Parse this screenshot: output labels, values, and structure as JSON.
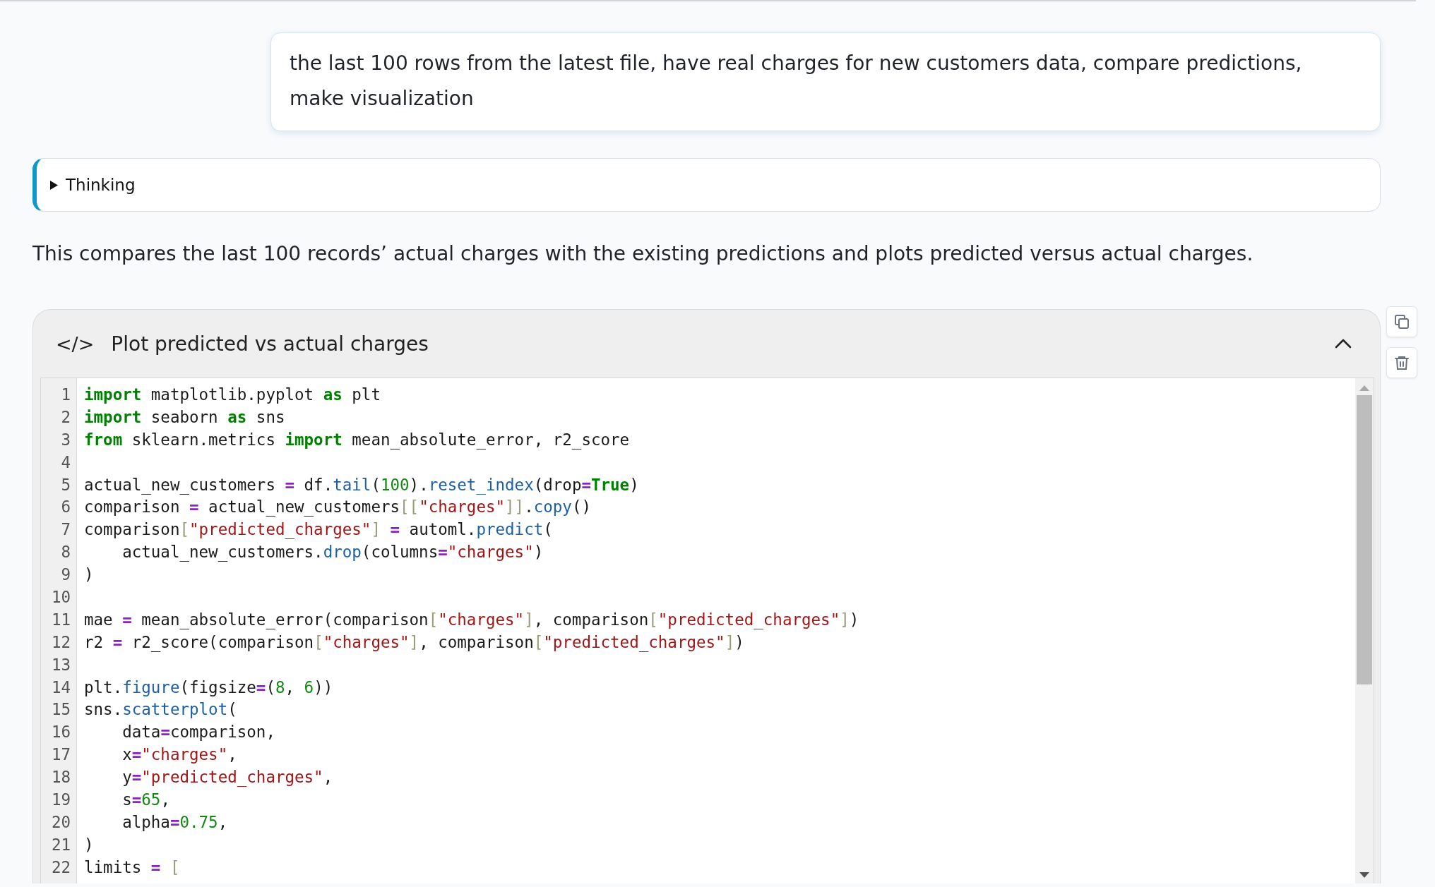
{
  "user_message": {
    "text": "the last 100 rows from the latest file, have real charges for new customers data, compare predictions, make visualization"
  },
  "thinking": {
    "label": "Thinking",
    "expanded": false
  },
  "assistant_text": "This compares the last 100 records’ actual charges with the existing predictions and plots predicted versus actual charges.",
  "code_block": {
    "tag": "</>",
    "title": "Plot predicted vs actual charges",
    "expanded": true,
    "lines": [
      {
        "number": "1",
        "tokens": [
          {
            "kind": "keyword",
            "text": "import"
          },
          {
            "kind": "plain",
            "text": " matplotlib.pyplot "
          },
          {
            "kind": "keyword",
            "text": "as"
          },
          {
            "kind": "plain",
            "text": " plt"
          }
        ]
      },
      {
        "number": "2",
        "tokens": [
          {
            "kind": "keyword",
            "text": "import"
          },
          {
            "kind": "plain",
            "text": " seaborn "
          },
          {
            "kind": "keyword",
            "text": "as"
          },
          {
            "kind": "plain",
            "text": " sns"
          }
        ]
      },
      {
        "number": "3",
        "tokens": [
          {
            "kind": "keyword",
            "text": "from"
          },
          {
            "kind": "plain",
            "text": " sklearn.metrics "
          },
          {
            "kind": "keyword",
            "text": "import"
          },
          {
            "kind": "plain",
            "text": " mean_absolute_error, r2_score"
          }
        ]
      },
      {
        "number": "4"
      },
      {
        "number": "5",
        "tokens": [
          {
            "kind": "plain",
            "text": "actual_new_customers "
          },
          {
            "kind": "operator",
            "text": "="
          },
          {
            "kind": "plain",
            "text": " df."
          },
          {
            "kind": "function",
            "text": "tail"
          },
          {
            "kind": "plain",
            "text": "("
          },
          {
            "kind": "number",
            "text": "100"
          },
          {
            "kind": "plain",
            "text": ")."
          },
          {
            "kind": "function",
            "text": "reset_index"
          },
          {
            "kind": "plain",
            "text": "(drop"
          },
          {
            "kind": "operator",
            "text": "="
          },
          {
            "kind": "keyword",
            "text": "True"
          },
          {
            "kind": "plain",
            "text": ")"
          }
        ]
      },
      {
        "number": "6",
        "tokens": [
          {
            "kind": "plain",
            "text": "comparison "
          },
          {
            "kind": "operator",
            "text": "="
          },
          {
            "kind": "plain",
            "text": " actual_new_customers"
          },
          {
            "kind": "bracket",
            "text": "[["
          },
          {
            "kind": "string",
            "text": "\"charges\""
          },
          {
            "kind": "bracket",
            "text": "]]"
          },
          {
            "kind": "plain",
            "text": "."
          },
          {
            "kind": "function",
            "text": "copy"
          },
          {
            "kind": "plain",
            "text": "()"
          }
        ]
      },
      {
        "number": "7",
        "tokens": [
          {
            "kind": "plain",
            "text": "comparison"
          },
          {
            "kind": "bracket",
            "text": "["
          },
          {
            "kind": "string",
            "text": "\"predicted_charges\""
          },
          {
            "kind": "bracket",
            "text": "]"
          },
          {
            "kind": "operator",
            "text": " ="
          },
          {
            "kind": "plain",
            "text": " automl."
          },
          {
            "kind": "function",
            "text": "predict"
          },
          {
            "kind": "plain",
            "text": "("
          }
        ]
      },
      {
        "number": "8",
        "tokens": [
          {
            "kind": "plain",
            "text": "    actual_new_customers."
          },
          {
            "kind": "function",
            "text": "drop"
          },
          {
            "kind": "plain",
            "text": "(columns"
          },
          {
            "kind": "operator",
            "text": "="
          },
          {
            "kind": "string",
            "text": "\"charges\""
          },
          {
            "kind": "plain",
            "text": ")"
          }
        ]
      },
      {
        "number": "9",
        "tokens": [
          {
            "kind": "plain",
            "text": ")"
          }
        ]
      },
      {
        "number": "10"
      },
      {
        "number": "11",
        "tokens": [
          {
            "kind": "plain",
            "text": "mae "
          },
          {
            "kind": "operator",
            "text": "="
          },
          {
            "kind": "plain",
            "text": " mean_absolute_error(comparison"
          },
          {
            "kind": "bracket",
            "text": "["
          },
          {
            "kind": "string",
            "text": "\"charges\""
          },
          {
            "kind": "bracket",
            "text": "]"
          },
          {
            "kind": "plain",
            "text": ", comparison"
          },
          {
            "kind": "bracket",
            "text": "["
          },
          {
            "kind": "string",
            "text": "\"predicted_charges\""
          },
          {
            "kind": "bracket",
            "text": "]"
          },
          {
            "kind": "plain",
            "text": ")"
          }
        ]
      },
      {
        "number": "12",
        "tokens": [
          {
            "kind": "plain",
            "text": "r2 "
          },
          {
            "kind": "operator",
            "text": "="
          },
          {
            "kind": "plain",
            "text": " r2_score(comparison"
          },
          {
            "kind": "bracket",
            "text": "["
          },
          {
            "kind": "string",
            "text": "\"charges\""
          },
          {
            "kind": "bracket",
            "text": "]"
          },
          {
            "kind": "plain",
            "text": ", comparison"
          },
          {
            "kind": "bracket",
            "text": "["
          },
          {
            "kind": "string",
            "text": "\"predicted_charges\""
          },
          {
            "kind": "bracket",
            "text": "]"
          },
          {
            "kind": "plain",
            "text": ")"
          }
        ]
      },
      {
        "number": "13"
      },
      {
        "number": "14",
        "tokens": [
          {
            "kind": "plain",
            "text": "plt."
          },
          {
            "kind": "function",
            "text": "figure"
          },
          {
            "kind": "plain",
            "text": "(figsize"
          },
          {
            "kind": "operator",
            "text": "="
          },
          {
            "kind": "plain",
            "text": "("
          },
          {
            "kind": "number",
            "text": "8"
          },
          {
            "kind": "plain",
            "text": ", "
          },
          {
            "kind": "number",
            "text": "6"
          },
          {
            "kind": "plain",
            "text": "))"
          }
        ]
      },
      {
        "number": "15",
        "tokens": [
          {
            "kind": "plain",
            "text": "sns."
          },
          {
            "kind": "function",
            "text": "scatterplot"
          },
          {
            "kind": "plain",
            "text": "("
          }
        ]
      },
      {
        "number": "16",
        "tokens": [
          {
            "kind": "plain",
            "text": "    data"
          },
          {
            "kind": "operator",
            "text": "="
          },
          {
            "kind": "plain",
            "text": "comparison,"
          }
        ]
      },
      {
        "number": "17",
        "tokens": [
          {
            "kind": "plain",
            "text": "    x"
          },
          {
            "kind": "operator",
            "text": "="
          },
          {
            "kind": "string",
            "text": "\"charges\""
          },
          {
            "kind": "plain",
            "text": ","
          }
        ]
      },
      {
        "number": "18",
        "tokens": [
          {
            "kind": "plain",
            "text": "    y"
          },
          {
            "kind": "operator",
            "text": "="
          },
          {
            "kind": "string",
            "text": "\"predicted_charges\""
          },
          {
            "kind": "plain",
            "text": ","
          }
        ]
      },
      {
        "number": "19",
        "tokens": [
          {
            "kind": "plain",
            "text": "    s"
          },
          {
            "kind": "operator",
            "text": "="
          },
          {
            "kind": "number",
            "text": "65"
          },
          {
            "kind": "plain",
            "text": ","
          }
        ]
      },
      {
        "number": "20",
        "tokens": [
          {
            "kind": "plain",
            "text": "    alpha"
          },
          {
            "kind": "operator",
            "text": "="
          },
          {
            "kind": "number",
            "text": "0.75"
          },
          {
            "kind": "plain",
            "text": ","
          }
        ]
      },
      {
        "number": "21",
        "tokens": [
          {
            "kind": "plain",
            "text": ")"
          }
        ]
      },
      {
        "number": "22",
        "tokens": [
          {
            "kind": "plain",
            "text": "limits "
          },
          {
            "kind": "operator",
            "text": "="
          },
          {
            "kind": "bracket",
            "text": " ["
          }
        ]
      }
    ]
  }
}
